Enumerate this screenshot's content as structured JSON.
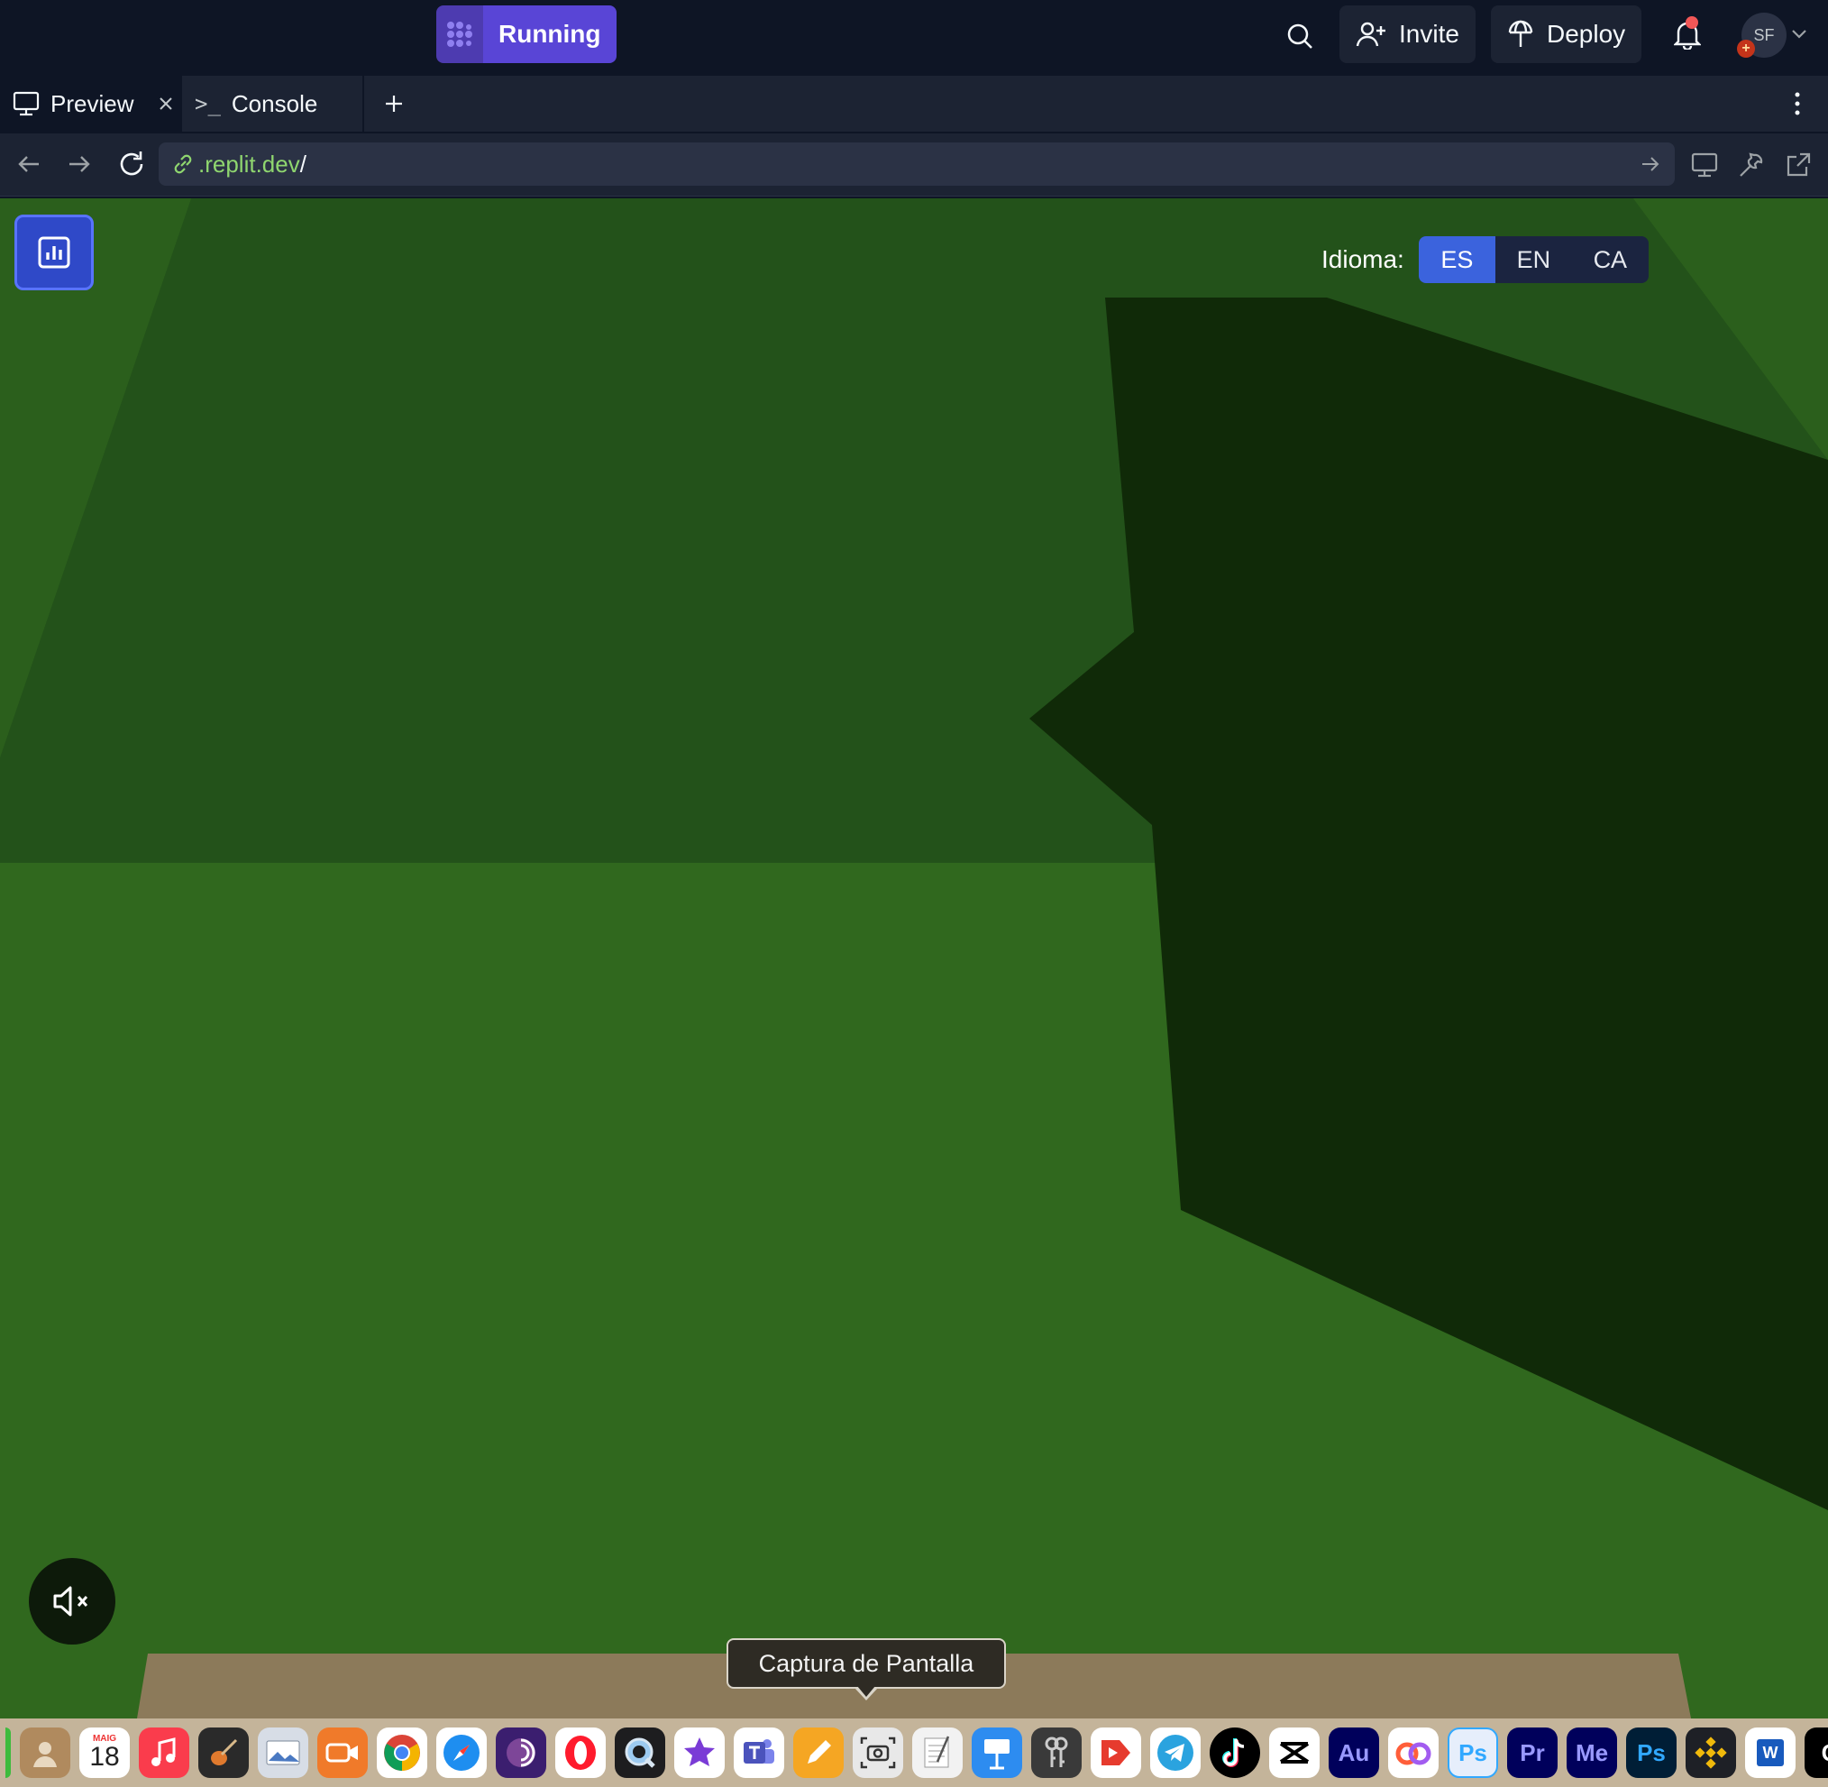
{
  "topbar": {
    "run_label": "Running",
    "invite_label": "Invite",
    "deploy_label": "Deploy",
    "avatar_initials": "SF",
    "avatar_badge": "+"
  },
  "tabs": [
    {
      "label": "Preview",
      "icon": "monitor-icon",
      "active": true
    },
    {
      "label": "Console",
      "icon": "terminal-icon",
      "active": false
    }
  ],
  "tabbar": {
    "terminal_prompt": ">_"
  },
  "urlbar": {
    "host": ".replit.dev",
    "path": "/"
  },
  "game": {
    "language_label": "Idioma:",
    "languages": [
      {
        "code": "ES",
        "active": true
      },
      {
        "code": "EN",
        "active": false
      },
      {
        "code": "CA",
        "active": false
      }
    ],
    "colors": {
      "ground": "#30681e",
      "back_wall": "#23521a",
      "shadow": "#102a08",
      "floor_edge": "#8c7a5a"
    }
  },
  "tooltip": {
    "text": "Captura de Pantalla"
  },
  "dock": {
    "calendar_month": "MAIG",
    "calendar_day": "18",
    "app_labels": [
      "Au",
      "Ps",
      "Pr",
      "Me",
      "Ps",
      "W",
      "C"
    ]
  }
}
